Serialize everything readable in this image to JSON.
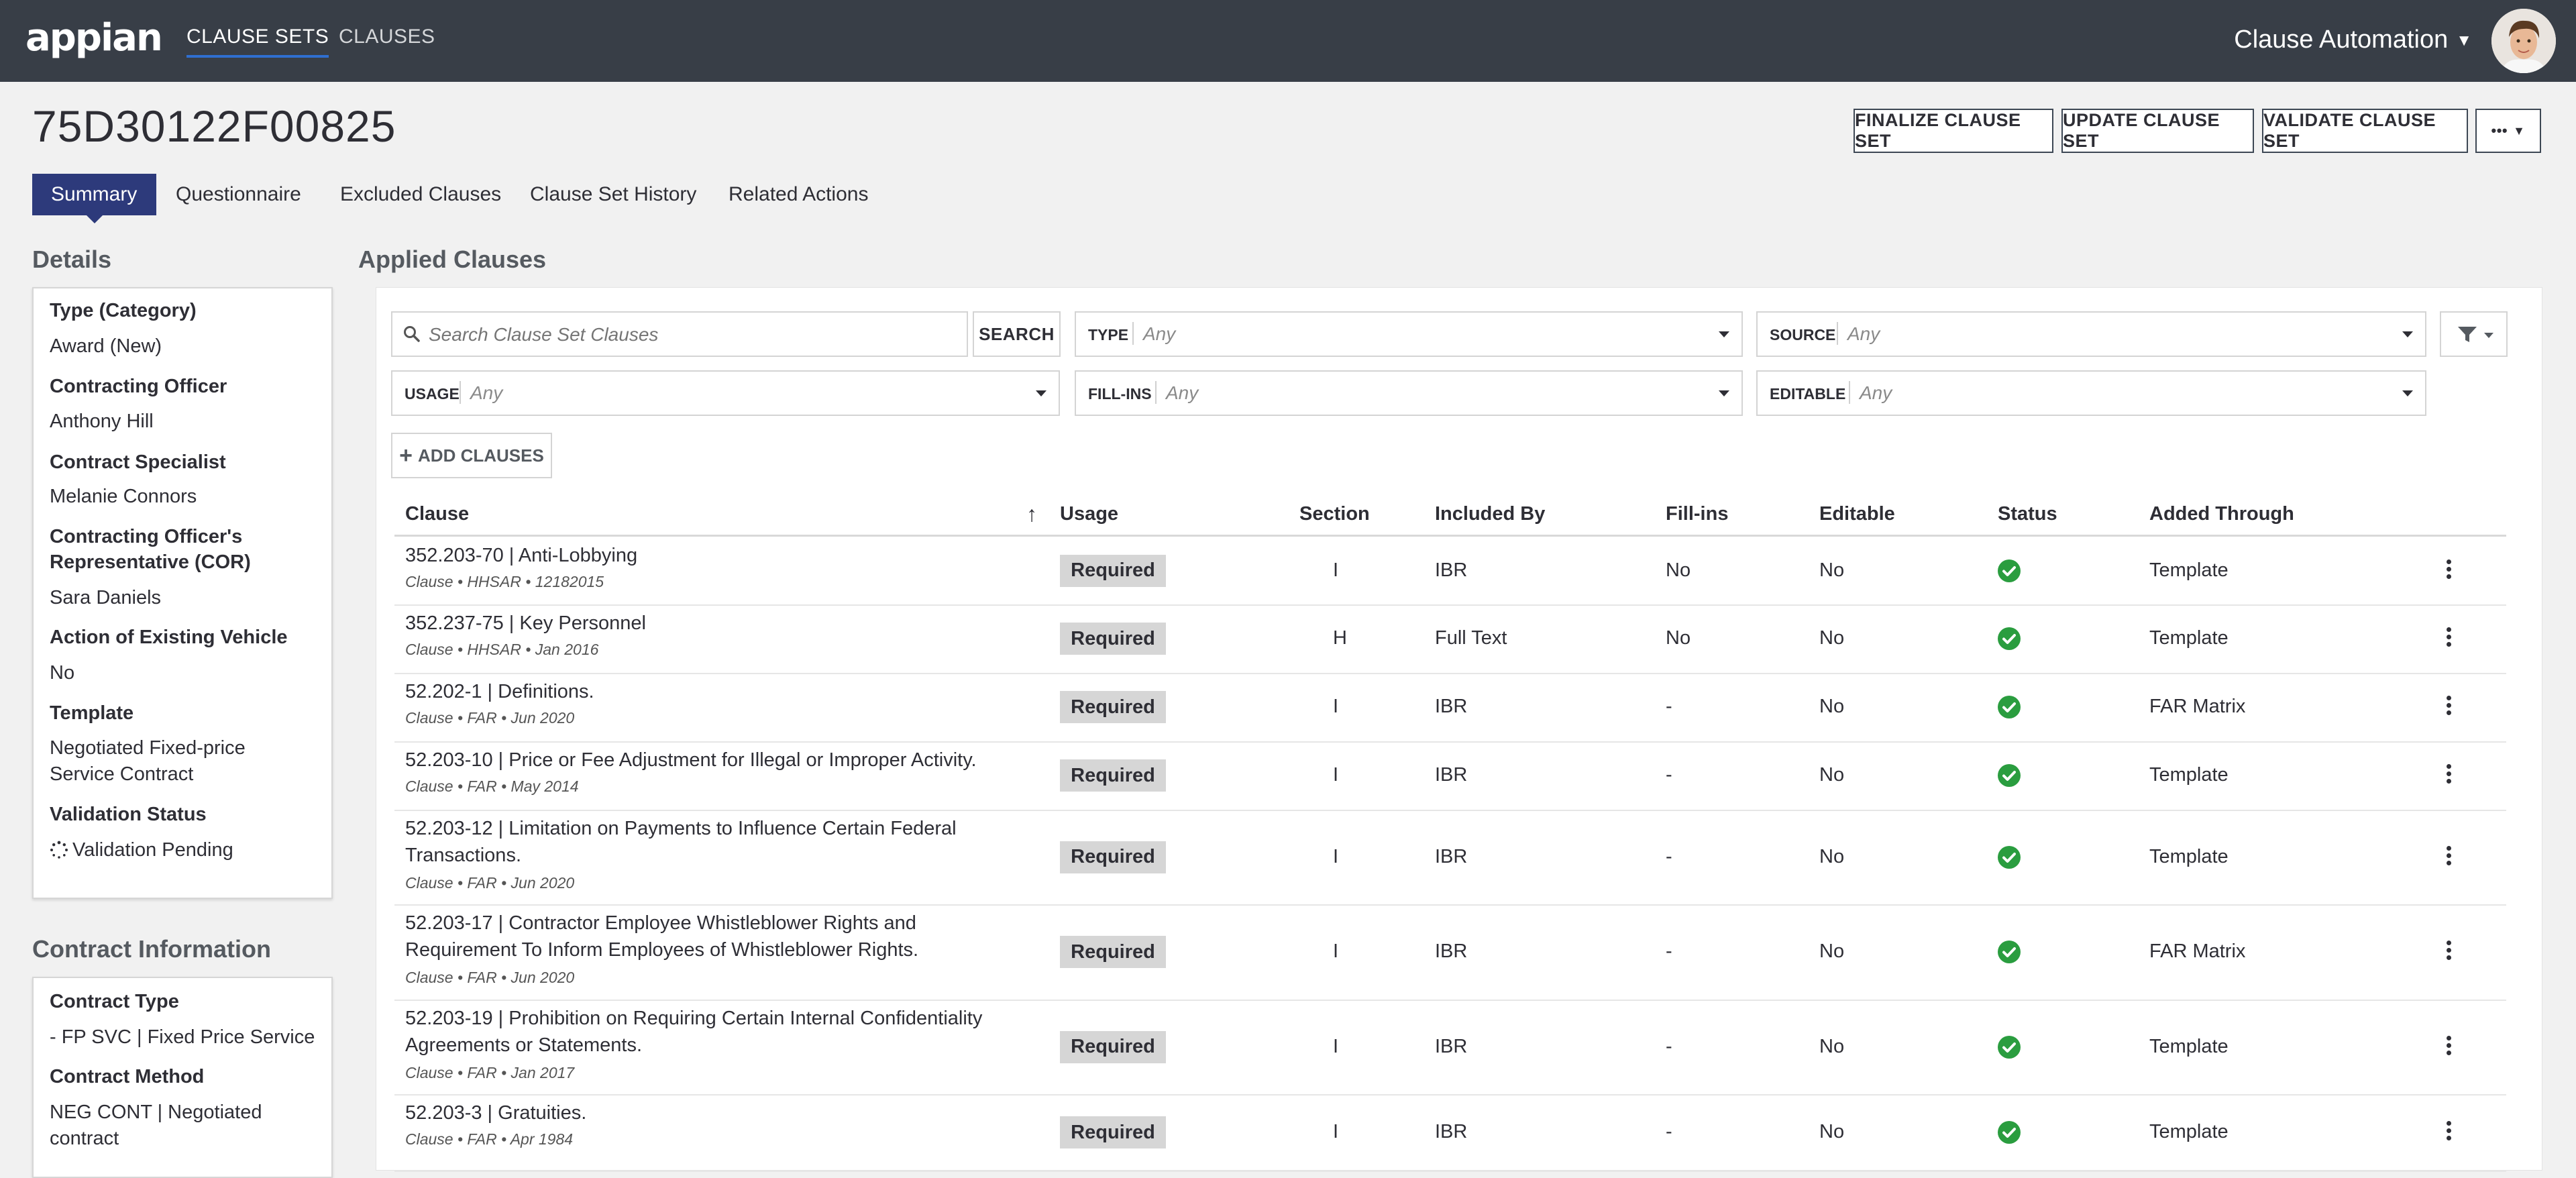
{
  "nav": {
    "logo": "appian",
    "tabs": [
      {
        "label": "CLAUSE SETS",
        "active": true
      },
      {
        "label": "CLAUSES",
        "active": false
      }
    ],
    "app_name": "Clause Automation"
  },
  "header": {
    "title": "75D30122F00825",
    "buttons": [
      "FINALIZE CLAUSE SET",
      "UPDATE CLAUSE SET",
      "VALIDATE CLAUSE SET"
    ],
    "more_label": "•••"
  },
  "record_tabs": [
    "Summary",
    "Questionnaire",
    "Excluded Clauses",
    "Clause Set History",
    "Related Actions"
  ],
  "details": {
    "title": "Details",
    "fields": [
      {
        "label": "Type (Category)",
        "value": "Award (New)"
      },
      {
        "label": "Contracting Officer",
        "value": "Anthony Hill"
      },
      {
        "label": "Contract Specialist",
        "value": "Melanie Connors"
      },
      {
        "label": "Contracting Officer's",
        "label2": "Representative (COR)",
        "value": "Sara Daniels"
      },
      {
        "label": "Action of Existing Vehicle",
        "value": "No"
      },
      {
        "label": "Template",
        "value": "Negotiated Fixed-price",
        "value2": "Service Contract"
      },
      {
        "label": "Validation Status",
        "value": "Validation Pending"
      }
    ]
  },
  "contract_info": {
    "title": "Contract Information",
    "fields": [
      {
        "label": "Contract Type",
        "value": "- FP SVC | Fixed Price Service"
      },
      {
        "label": "Contract Method",
        "value": "NEG CONT | Negotiated",
        "value2": "contract"
      }
    ]
  },
  "applied": {
    "title": "Applied Clauses",
    "search_placeholder": "Search Clause Set Clauses",
    "search_button": "SEARCH",
    "filters": [
      {
        "label": "TYPE",
        "value": "Any"
      },
      {
        "label": "SOURCE",
        "value": "Any"
      },
      {
        "label": "USAGE",
        "value": "Any"
      },
      {
        "label": "FILL-INS",
        "value": "Any"
      },
      {
        "label": "EDITABLE",
        "value": "Any"
      }
    ],
    "add_button": "ADD CLAUSES",
    "columns": [
      "Clause",
      "Usage",
      "Section",
      "Included By",
      "Fill-ins",
      "Editable",
      "Status",
      "Added Through"
    ],
    "status_color": "#2a9d3f",
    "rows": [
      {
        "title": "352.203-70 | Anti-Lobbying",
        "title2": "",
        "meta": "Clause • HHSAR • 12182015",
        "usage": "Required",
        "section": "I",
        "included_by": "IBR",
        "fill_ins": "No",
        "editable": "No",
        "added_through": "Template"
      },
      {
        "title": "352.237-75 | Key Personnel",
        "title2": "",
        "meta": "Clause • HHSAR • Jan 2016",
        "usage": "Required",
        "section": "H",
        "included_by": "Full Text",
        "fill_ins": "No",
        "editable": "No",
        "added_through": "Template"
      },
      {
        "title": "52.202-1 | Definitions.",
        "title2": "",
        "meta": "Clause • FAR • Jun 2020",
        "usage": "Required",
        "section": "I",
        "included_by": "IBR",
        "fill_ins": "-",
        "editable": "No",
        "added_through": "FAR Matrix"
      },
      {
        "title": "52.203-10 | Price or Fee Adjustment for Illegal or Improper Activity.",
        "title2": "",
        "meta": "Clause • FAR • May 2014",
        "usage": "Required",
        "section": "I",
        "included_by": "IBR",
        "fill_ins": "-",
        "editable": "No",
        "added_through": "Template"
      },
      {
        "title": "52.203-12 | Limitation on Payments to Influence Certain Federal",
        "title2": "Transactions.",
        "meta": "Clause • FAR • Jun 2020",
        "usage": "Required",
        "section": "I",
        "included_by": "IBR",
        "fill_ins": "-",
        "editable": "No",
        "added_through": "Template"
      },
      {
        "title": "52.203-17 | Contractor Employee Whistleblower Rights and",
        "title2": "Requirement To Inform Employees of Whistleblower Rights.",
        "meta": "Clause • FAR • Jun 2020",
        "usage": "Required",
        "section": "I",
        "included_by": "IBR",
        "fill_ins": "-",
        "editable": "No",
        "added_through": "FAR Matrix"
      },
      {
        "title": "52.203-19 | Prohibition on Requiring Certain Internal Confidentiality",
        "title2": "Agreements or Statements.",
        "meta": "Clause • FAR • Jan 2017",
        "usage": "Required",
        "section": "I",
        "included_by": "IBR",
        "fill_ins": "-",
        "editable": "No",
        "added_through": "Template"
      },
      {
        "title": "52.203-3 | Gratuities.",
        "title2": "",
        "meta": "Clause • FAR • Apr 1984",
        "usage": "Required",
        "section": "I",
        "included_by": "IBR",
        "fill_ins": "-",
        "editable": "No",
        "added_through": "Template"
      }
    ]
  }
}
